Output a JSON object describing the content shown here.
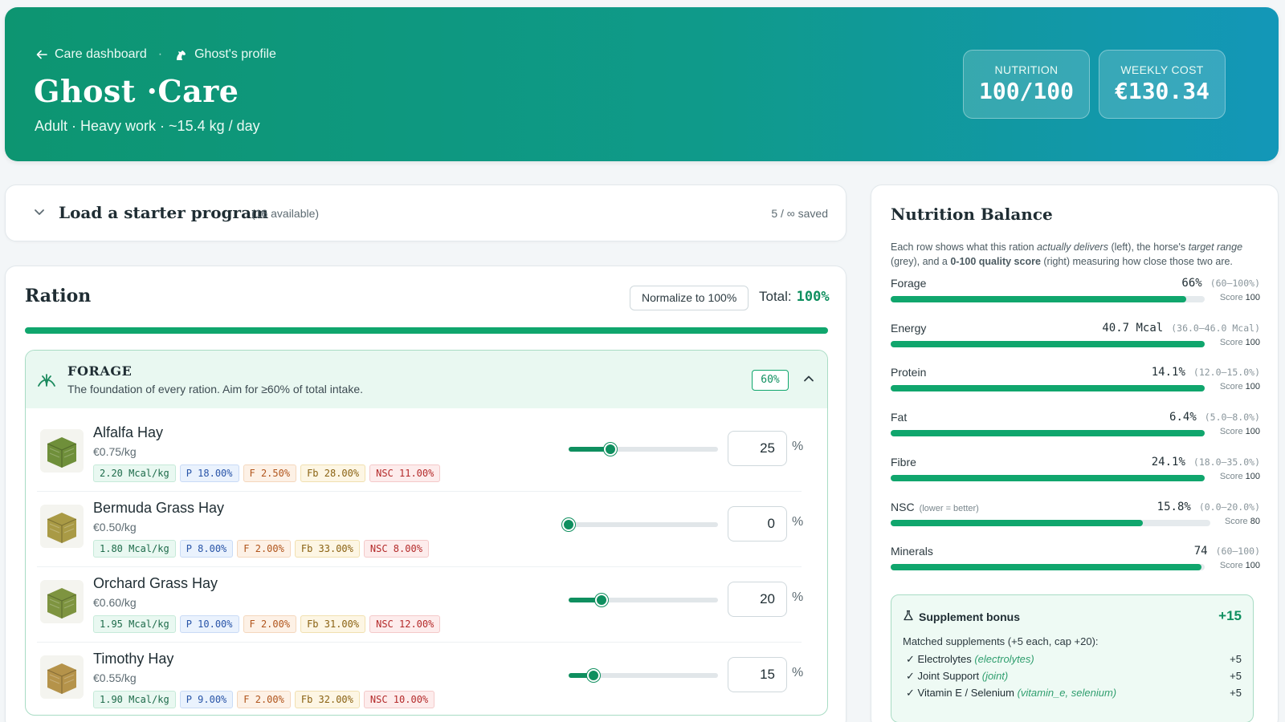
{
  "header": {
    "back_label": "Care dashboard",
    "profile_label": "Ghost's profile",
    "title": "Ghost  ·Care",
    "subtitle": "Adult · Heavy work · ~15.4 kg / day",
    "stats": [
      {
        "label": "NUTRITION",
        "value": "100/100"
      },
      {
        "label": "WEEKLY COST",
        "value": "€130.34"
      }
    ]
  },
  "starter": {
    "title": "Load a starter program",
    "count": "(16 available)",
    "saved": "5 / ∞ saved"
  },
  "ration": {
    "title": "Ration",
    "normalize_label": "Normalize to 100%",
    "total_label": "Total:",
    "total_value": "100%",
    "total_fill": 1.0,
    "group": {
      "name": "FORAGE",
      "description": "The foundation of every ration. Aim for ≥60% of total intake.",
      "percent": "60%"
    },
    "feeds": [
      {
        "name": "Alfalfa Hay",
        "price": "€0.75/kg",
        "energy": "2.20 Mcal/kg",
        "protein": "P 18.00%",
        "fat": "F 2.50%",
        "fibre": "Fb 28.00%",
        "nsc": "NSC 11.00%",
        "value": "25",
        "pct": 25,
        "color": "#6f8f3a"
      },
      {
        "name": "Bermuda Grass Hay",
        "price": "€0.50/kg",
        "energy": "1.80 Mcal/kg",
        "protein": "P 8.00%",
        "fat": "F 2.00%",
        "fibre": "Fb 33.00%",
        "nsc": "NSC 8.00%",
        "value": "0",
        "pct": 0,
        "color": "#a99a45"
      },
      {
        "name": "Orchard Grass Hay",
        "price": "€0.60/kg",
        "energy": "1.95 Mcal/kg",
        "protein": "P 10.00%",
        "fat": "F 2.00%",
        "fibre": "Fb 31.00%",
        "nsc": "NSC 12.00%",
        "value": "20",
        "pct": 20,
        "color": "#7e9440"
      },
      {
        "name": "Timothy Hay",
        "price": "€0.55/kg",
        "energy": "1.90 Mcal/kg",
        "protein": "P 9.00%",
        "fat": "F 2.00%",
        "fibre": "Fb 32.00%",
        "nsc": "NSC 10.00%",
        "value": "15",
        "pct": 15,
        "color": "#b5934a"
      }
    ],
    "percent_sign": "%"
  },
  "nutrition": {
    "title": "Nutrition Balance",
    "intro_1": "Each row shows what this ration ",
    "intro_2": "actually delivers",
    "intro_3": " (left), the horse's ",
    "intro_4": "target range",
    "intro_5": " (grey), and a ",
    "intro_6": "0-100 quality score",
    "intro_7": " (right) measuring how close those two are.",
    "rows": [
      {
        "label": "Forage",
        "note": "",
        "value": "66%",
        "range": "(60–100%)",
        "score_label": "Score",
        "score": "100",
        "fill": 0.94
      },
      {
        "label": "Energy",
        "note": "",
        "value": "40.7 Mcal",
        "range": "(36.0–46.0 Mcal)",
        "score_label": "Score",
        "score": "100",
        "fill": 1.0
      },
      {
        "label": "Protein",
        "note": "",
        "value": "14.1%",
        "range": "(12.0–15.0%)",
        "score_label": "Score",
        "score": "100",
        "fill": 1.0
      },
      {
        "label": "Fat",
        "note": "",
        "value": "6.4%",
        "range": "(5.0–8.0%)",
        "score_label": "Score",
        "score": "100",
        "fill": 1.0
      },
      {
        "label": "Fibre",
        "note": "",
        "value": "24.1%",
        "range": "(18.0–35.0%)",
        "score_label": "Score",
        "score": "100",
        "fill": 1.0
      },
      {
        "label": "NSC",
        "note": "(lower = better)",
        "value": "15.8%",
        "range": "(0.0–20.0%)",
        "score_label": "Score",
        "score": "80",
        "fill": 0.79
      },
      {
        "label": "Minerals",
        "note": "",
        "value": "74",
        "range": "(60–100)",
        "score_label": "Score",
        "score": "100",
        "fill": 0.99
      }
    ],
    "bonus": {
      "title": "Supplement bonus",
      "total": "+15",
      "matched_label": "Matched supplements (+5 each, cap +20):",
      "items": [
        {
          "name": "✓ Electrolytes",
          "key": "(electrolytes)",
          "points": "+5"
        },
        {
          "name": "✓ Joint Support",
          "key": "(joint)",
          "points": "+5"
        },
        {
          "name": "✓ Vitamin E / Selenium",
          "key": "(vitamin_e, selenium)",
          "points": "+5"
        }
      ]
    }
  }
}
